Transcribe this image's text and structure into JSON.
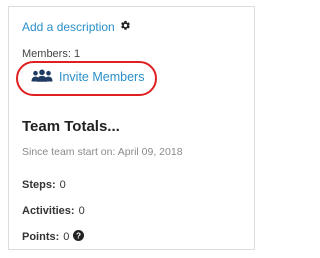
{
  "team_panel": {
    "description_link": "Add a description",
    "members_label": "Members:",
    "members_count": "1",
    "invite_label": "Invite Members",
    "totals_title": "Team Totals...",
    "since_label": "Since team start on:",
    "since_date": "April 09, 2018",
    "stats": [
      {
        "label": "Steps:",
        "value": "0"
      },
      {
        "label": "Activities:",
        "value": "0"
      },
      {
        "label": "Points:",
        "value": "0"
      }
    ]
  },
  "icons": {
    "description": "gear-icon",
    "invite": "people-group-icon",
    "points": "question-circle-icon"
  },
  "colors": {
    "link": "#2a8fc9",
    "highlight": "#e02020",
    "muted": "#8a8a8a"
  }
}
